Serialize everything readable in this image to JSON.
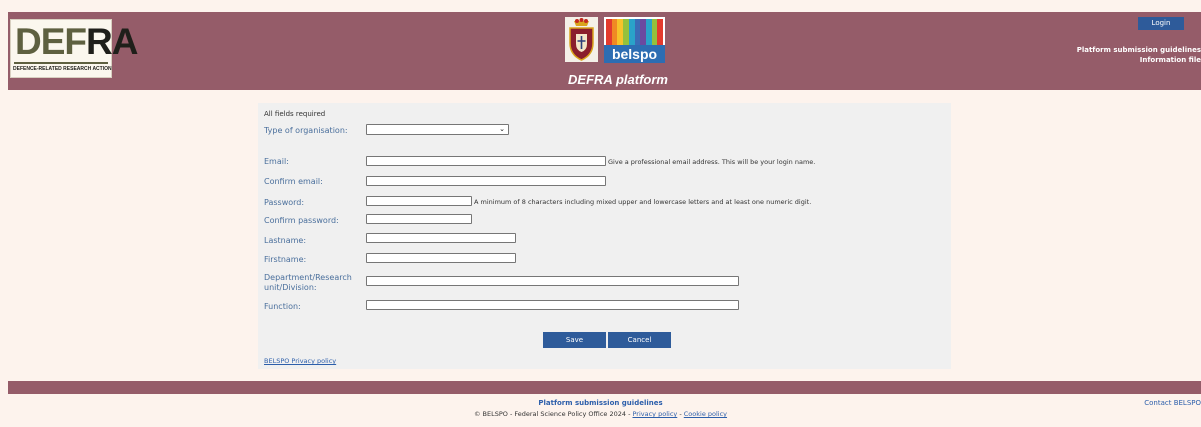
{
  "header": {
    "logo_defra_letters_a": "DEF",
    "logo_defra_letters_b": "RA",
    "logo_defra_tagline": "DEFENCE-RELATED RESEARCH ACTION",
    "logo_belspo_text": "belspo",
    "platform_title": "DEFRA platform",
    "login_label": "Login",
    "guidelines_link": "Platform submission guidelines",
    "info_link": "Information file",
    "colors": {
      "band": "#955c69",
      "button": "#2e5b9a"
    }
  },
  "form": {
    "required_note": "All fields required",
    "org_type_label": "Type of organisation:",
    "org_type_value": "",
    "email_label": "Email:",
    "email_hint": "Give a professional email address. This will be your login name.",
    "confirm_email_label": "Confirm email:",
    "password_label": "Password:",
    "password_hint": "A minimum of 8 characters including mixed upper and lowercase letters and at least one numeric digit.",
    "confirm_password_label": "Confirm password:",
    "lastname_label": "Lastname:",
    "firstname_label": "Firstname:",
    "department_label": "Department/Research unit/Division:",
    "function_label": "Function:",
    "save_label": "Save",
    "cancel_label": "Cancel",
    "privacy_link": "BELSPO Privacy policy"
  },
  "footer": {
    "guidelines_link": "Platform submission guidelines",
    "copyright": "© BELSPO - Federal Science Policy Office 2024 -",
    "sep": "-",
    "privacy_link": "Privacy policy",
    "cookie_link": "Cookie policy",
    "contact_link": "Contact BELSPO"
  }
}
